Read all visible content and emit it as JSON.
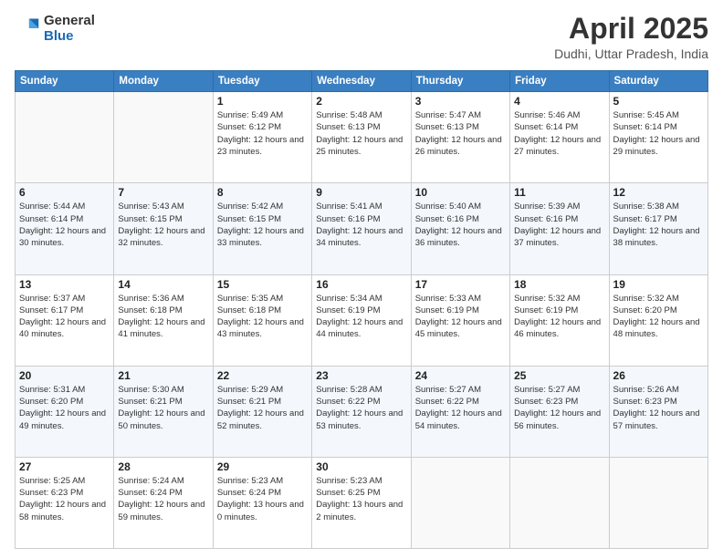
{
  "header": {
    "logo_general": "General",
    "logo_blue": "Blue",
    "title": "April 2025",
    "location": "Dudhi, Uttar Pradesh, India"
  },
  "weekdays": [
    "Sunday",
    "Monday",
    "Tuesday",
    "Wednesday",
    "Thursday",
    "Friday",
    "Saturday"
  ],
  "weeks": [
    [
      {
        "day": "",
        "info": ""
      },
      {
        "day": "",
        "info": ""
      },
      {
        "day": "1",
        "info": "Sunrise: 5:49 AM\nSunset: 6:12 PM\nDaylight: 12 hours and 23 minutes."
      },
      {
        "day": "2",
        "info": "Sunrise: 5:48 AM\nSunset: 6:13 PM\nDaylight: 12 hours and 25 minutes."
      },
      {
        "day": "3",
        "info": "Sunrise: 5:47 AM\nSunset: 6:13 PM\nDaylight: 12 hours and 26 minutes."
      },
      {
        "day": "4",
        "info": "Sunrise: 5:46 AM\nSunset: 6:14 PM\nDaylight: 12 hours and 27 minutes."
      },
      {
        "day": "5",
        "info": "Sunrise: 5:45 AM\nSunset: 6:14 PM\nDaylight: 12 hours and 29 minutes."
      }
    ],
    [
      {
        "day": "6",
        "info": "Sunrise: 5:44 AM\nSunset: 6:14 PM\nDaylight: 12 hours and 30 minutes."
      },
      {
        "day": "7",
        "info": "Sunrise: 5:43 AM\nSunset: 6:15 PM\nDaylight: 12 hours and 32 minutes."
      },
      {
        "day": "8",
        "info": "Sunrise: 5:42 AM\nSunset: 6:15 PM\nDaylight: 12 hours and 33 minutes."
      },
      {
        "day": "9",
        "info": "Sunrise: 5:41 AM\nSunset: 6:16 PM\nDaylight: 12 hours and 34 minutes."
      },
      {
        "day": "10",
        "info": "Sunrise: 5:40 AM\nSunset: 6:16 PM\nDaylight: 12 hours and 36 minutes."
      },
      {
        "day": "11",
        "info": "Sunrise: 5:39 AM\nSunset: 6:16 PM\nDaylight: 12 hours and 37 minutes."
      },
      {
        "day": "12",
        "info": "Sunrise: 5:38 AM\nSunset: 6:17 PM\nDaylight: 12 hours and 38 minutes."
      }
    ],
    [
      {
        "day": "13",
        "info": "Sunrise: 5:37 AM\nSunset: 6:17 PM\nDaylight: 12 hours and 40 minutes."
      },
      {
        "day": "14",
        "info": "Sunrise: 5:36 AM\nSunset: 6:18 PM\nDaylight: 12 hours and 41 minutes."
      },
      {
        "day": "15",
        "info": "Sunrise: 5:35 AM\nSunset: 6:18 PM\nDaylight: 12 hours and 43 minutes."
      },
      {
        "day": "16",
        "info": "Sunrise: 5:34 AM\nSunset: 6:19 PM\nDaylight: 12 hours and 44 minutes."
      },
      {
        "day": "17",
        "info": "Sunrise: 5:33 AM\nSunset: 6:19 PM\nDaylight: 12 hours and 45 minutes."
      },
      {
        "day": "18",
        "info": "Sunrise: 5:32 AM\nSunset: 6:19 PM\nDaylight: 12 hours and 46 minutes."
      },
      {
        "day": "19",
        "info": "Sunrise: 5:32 AM\nSunset: 6:20 PM\nDaylight: 12 hours and 48 minutes."
      }
    ],
    [
      {
        "day": "20",
        "info": "Sunrise: 5:31 AM\nSunset: 6:20 PM\nDaylight: 12 hours and 49 minutes."
      },
      {
        "day": "21",
        "info": "Sunrise: 5:30 AM\nSunset: 6:21 PM\nDaylight: 12 hours and 50 minutes."
      },
      {
        "day": "22",
        "info": "Sunrise: 5:29 AM\nSunset: 6:21 PM\nDaylight: 12 hours and 52 minutes."
      },
      {
        "day": "23",
        "info": "Sunrise: 5:28 AM\nSunset: 6:22 PM\nDaylight: 12 hours and 53 minutes."
      },
      {
        "day": "24",
        "info": "Sunrise: 5:27 AM\nSunset: 6:22 PM\nDaylight: 12 hours and 54 minutes."
      },
      {
        "day": "25",
        "info": "Sunrise: 5:27 AM\nSunset: 6:23 PM\nDaylight: 12 hours and 56 minutes."
      },
      {
        "day": "26",
        "info": "Sunrise: 5:26 AM\nSunset: 6:23 PM\nDaylight: 12 hours and 57 minutes."
      }
    ],
    [
      {
        "day": "27",
        "info": "Sunrise: 5:25 AM\nSunset: 6:23 PM\nDaylight: 12 hours and 58 minutes."
      },
      {
        "day": "28",
        "info": "Sunrise: 5:24 AM\nSunset: 6:24 PM\nDaylight: 12 hours and 59 minutes."
      },
      {
        "day": "29",
        "info": "Sunrise: 5:23 AM\nSunset: 6:24 PM\nDaylight: 13 hours and 0 minutes."
      },
      {
        "day": "30",
        "info": "Sunrise: 5:23 AM\nSunset: 6:25 PM\nDaylight: 13 hours and 2 minutes."
      },
      {
        "day": "",
        "info": ""
      },
      {
        "day": "",
        "info": ""
      },
      {
        "day": "",
        "info": ""
      }
    ]
  ]
}
